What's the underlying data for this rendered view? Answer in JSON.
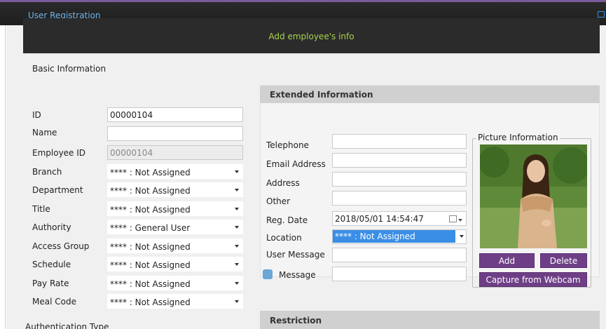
{
  "window": {
    "title": "User Registration"
  },
  "banner": {
    "text": "Add employee's info"
  },
  "basic": {
    "section_label": "Basic Information",
    "id": {
      "label": "ID",
      "value": "00000104"
    },
    "name": {
      "label": "Name",
      "value": ""
    },
    "employee_id": {
      "label": "Employee ID",
      "value": "00000104"
    },
    "branch": {
      "label": "Branch",
      "value": "**** : Not Assigned"
    },
    "department": {
      "label": "Department",
      "value": "**** : Not Assigned"
    },
    "title": {
      "label": "Title",
      "value": "**** : Not Assigned"
    },
    "authority": {
      "label": "Authority",
      "value": "**** : General User"
    },
    "access_group": {
      "label": "Access Group",
      "value": "**** : Not Assigned"
    },
    "schedule": {
      "label": "Schedule",
      "value": "**** : Not Assigned"
    },
    "pay_rate": {
      "label": "Pay Rate",
      "value": "**** : Not Assigned"
    },
    "meal_code": {
      "label": "Meal Code",
      "value": "**** : Not Assigned"
    },
    "auth_type_label": "Authentication Type"
  },
  "extended": {
    "header": "Extended Information",
    "telephone": {
      "label": "Telephone",
      "value": ""
    },
    "email": {
      "label": "Email Address",
      "value": ""
    },
    "address": {
      "label": "Address",
      "value": ""
    },
    "other": {
      "label": "Other",
      "value": ""
    },
    "reg_date": {
      "label": "Reg. Date",
      "value": "2018/05/01 14:54:47"
    },
    "location": {
      "label": "Location",
      "value": "**** : Not Assigned"
    },
    "user_message": {
      "label": "User Message",
      "value": ""
    },
    "message": {
      "label": "Message",
      "value": "",
      "color": "#6aa6d6"
    }
  },
  "picture": {
    "legend": "Picture Information",
    "add_label": "Add",
    "delete_label": "Delete",
    "webcam_label": "Capture from Webcam"
  },
  "restriction": {
    "header": "Restriction"
  },
  "colors": {
    "accent": "#6e3f86",
    "title_text": "#6fb4e8",
    "banner_text": "#a8d24a",
    "selection": "#3a8ee6"
  }
}
